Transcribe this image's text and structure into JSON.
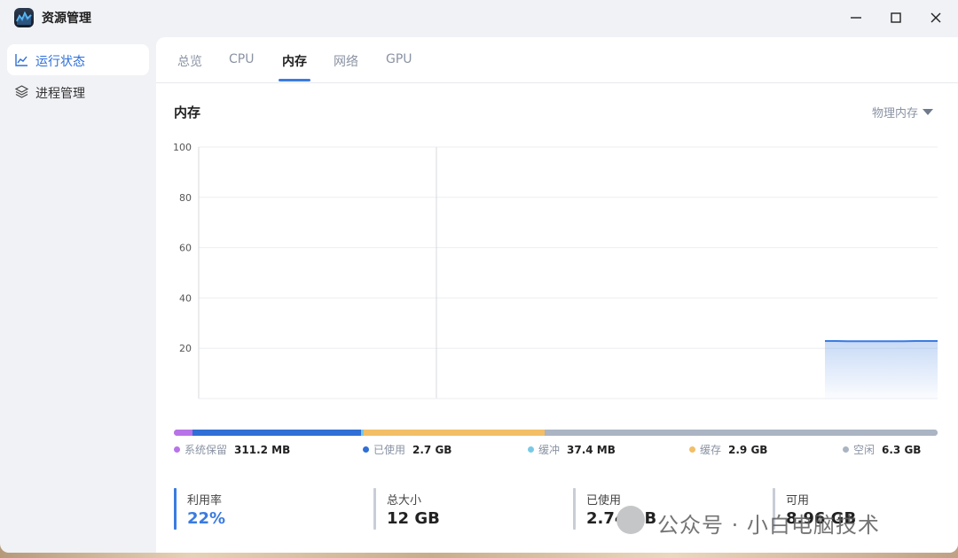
{
  "app": {
    "title": "资源管理",
    "icon": "resource-monitor-app-icon"
  },
  "window_controls": {
    "minimize": "minimize-icon",
    "maximize": "maximize-icon",
    "close": "close-icon"
  },
  "sidebar": {
    "items": [
      {
        "label": "运行状态",
        "icon": "line-chart-icon",
        "active": true
      },
      {
        "label": "进程管理",
        "icon": "layers-icon",
        "active": false
      }
    ]
  },
  "tabs": [
    {
      "label": "总览",
      "active": false
    },
    {
      "label": "CPU",
      "active": false
    },
    {
      "label": "内存",
      "active": true
    },
    {
      "label": "网络",
      "active": false
    },
    {
      "label": "GPU",
      "active": false
    }
  ],
  "section": {
    "title": "内存",
    "dropdown": "物理内存"
  },
  "chart_data": {
    "type": "area",
    "title": "",
    "xlabel": "",
    "ylabel": "",
    "ylim": [
      0,
      100
    ],
    "yticks": [
      "100",
      "80",
      "60",
      "40",
      "20"
    ],
    "grid": true,
    "series": [
      {
        "values": [
          22.9,
          22.9,
          22.8,
          22.8,
          22.8,
          22.8,
          22.8,
          22.8,
          22.9,
          22.9,
          22.9
        ],
        "color": "#3a7be0"
      }
    ]
  },
  "memory_breakdown": {
    "total_gb": 12,
    "segments": [
      {
        "name": "系统保留",
        "value": "311.2 MB",
        "gb": 0.304,
        "color": "#b873e8"
      },
      {
        "name": "已使用",
        "value": "2.7 GB",
        "gb": 2.7,
        "color": "#2f6fd6"
      },
      {
        "name": "缓冲",
        "value": "37.4 MB",
        "gb": 0.037,
        "color": "#79c9e6"
      },
      {
        "name": "缓存",
        "value": "2.9 GB",
        "gb": 2.9,
        "color": "#f2bf66"
      },
      {
        "name": "空闲",
        "value": "6.3 GB",
        "gb": 6.3,
        "color": "#aab4c3"
      }
    ]
  },
  "stats": [
    {
      "label": "利用率",
      "value": "22%"
    },
    {
      "label": "总大小",
      "value": "12 GB"
    },
    {
      "label": "已使用",
      "value": "2.74 GB"
    },
    {
      "label": "可用",
      "value": "8.96 GB"
    }
  ],
  "watermark": {
    "text": "公众号 · 小白电脑技术"
  }
}
